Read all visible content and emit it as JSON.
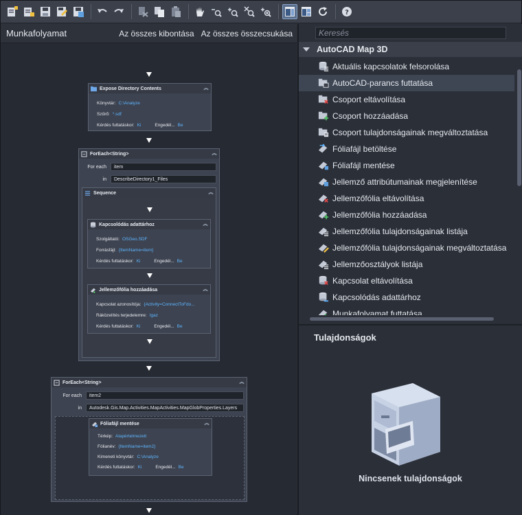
{
  "toolbar": {
    "buttons": [
      "new-workflow-icon",
      "open-workflow-icon",
      "save-icon",
      "save-as-icon",
      "export-icon",
      "undo-icon",
      "redo-icon",
      "cut-icon",
      "copy-icon",
      "paste-icon",
      "pan-hand-icon",
      "zoom-out-icon",
      "zoom-in-icon",
      "zoom-extents-icon",
      "zoom-window-icon",
      "layout-vertical-icon",
      "layout-horizontal-icon",
      "refresh-icon",
      "help-icon"
    ]
  },
  "left": {
    "title": "Munkafolyamat",
    "expand_all": "Az összes kibontása",
    "collapse_all": "Az összes összecsukása"
  },
  "workflow": {
    "expose": {
      "title": "Expose Directory Contents",
      "lib_label": "Könyvtár:",
      "lib_value": "C:\\Analyze",
      "filter_label": "Szűrő:",
      "filter_value": "*.sdf",
      "ask_label": "Kérdés futtatáskor:",
      "ask_value": "Ki",
      "enable_label": "Engedél...",
      "enable_value": "Be"
    },
    "foreach1": {
      "title": "ForEach<String>",
      "for_each_label": "For each",
      "for_each_value": "item",
      "in_label": "in",
      "in_value": "DescribeDirectory1_Files"
    },
    "sequence": {
      "title": "Sequence"
    },
    "connect": {
      "title": "Kapcsolódás adattárhoz",
      "provider_label": "Szolgáltató:",
      "provider_value": "OSGeo.SDF",
      "source_label": "Forrásfájl:",
      "source_value": "{ItemName=item}",
      "ask_label": "Kérdés futtatáskor:",
      "ask_value": "Ki",
      "enable_label": "Engedél...",
      "enable_value": "Be"
    },
    "addlayer": {
      "title": "Jellemzőfólia hozzáadása",
      "conn_label": "Kapcsolat azonosítója:",
      "conn_value": "{Activity=ConnectToFdo...",
      "zoom_label": "Ráközelítés terjedelemre:",
      "zoom_value": "Igaz",
      "ask_label": "Kérdés futtatáskor:",
      "ask_value": "Ki",
      "enable_label": "Engedél...",
      "enable_value": "Be"
    },
    "foreach2": {
      "title": "ForEach<String>",
      "for_each_label": "For each",
      "for_each_value": "item2",
      "in_label": "in",
      "in_value": "Autodesk.Gis.Map.Activities.MapActivities.MapGlobProperties.Layers"
    },
    "savelayer": {
      "title": "Fóliafájl mentése",
      "map_label": "Térkép:",
      "map_value": "Alapértelmezett",
      "layer_label": "Fólianév:",
      "layer_value": "{ItemName=item2}",
      "out_label": "Kimeneti könyvtár:",
      "out_value": "C:\\Analyze",
      "ask_label": "Kérdés futtatáskor:",
      "ask_value": "Ki",
      "enable_label": "Engedél...",
      "enable_value": "Be"
    }
  },
  "right": {
    "search_placeholder": "Keresés",
    "group_title": "AutoCAD Map 3D",
    "items": [
      {
        "label": "Aktuális kapcsolatok felsorolása",
        "icon": "db-list-icon"
      },
      {
        "label": "AutoCAD-parancs futtatása",
        "icon": "command-icon"
      },
      {
        "label": "Csoport eltávolítása",
        "icon": "folder-remove-icon"
      },
      {
        "label": "Csoport hozzáadása",
        "icon": "folder-add-icon"
      },
      {
        "label": "Csoport tulajdonságainak megváltoztatása",
        "icon": "folder-props-icon"
      },
      {
        "label": "Fóliafájl betöltése",
        "icon": "layer-load-icon"
      },
      {
        "label": "Fóliafájl mentése",
        "icon": "layer-save-icon"
      },
      {
        "label": "Jellemző attribútumainak megjelenítése",
        "icon": "feature-attr-icon"
      },
      {
        "label": "Jellemzőfólia eltávolítása",
        "icon": "layer-remove-icon"
      },
      {
        "label": "Jellemzőfólia hozzáadása",
        "icon": "layer-add-icon"
      },
      {
        "label": "Jellemzőfólia tulajdonságainak listája",
        "icon": "layer-list-icon"
      },
      {
        "label": "Jellemzőfólia tulajdonságainak megváltoztatása",
        "icon": "layer-edit-icon"
      },
      {
        "label": "Jellemzőosztályok listája",
        "icon": "class-list-icon"
      },
      {
        "label": "Kapcsolat eltávolítása",
        "icon": "db-remove-icon"
      },
      {
        "label": "Kapcsolódás adattárhoz",
        "icon": "db-connect-icon"
      },
      {
        "label": "Munkafolyamat futtatása",
        "icon": "workflow-run-icon"
      }
    ],
    "selected_index": 1,
    "properties_title": "Tulajdonságok",
    "no_properties": "Nincsenek tulajdonságok"
  }
}
